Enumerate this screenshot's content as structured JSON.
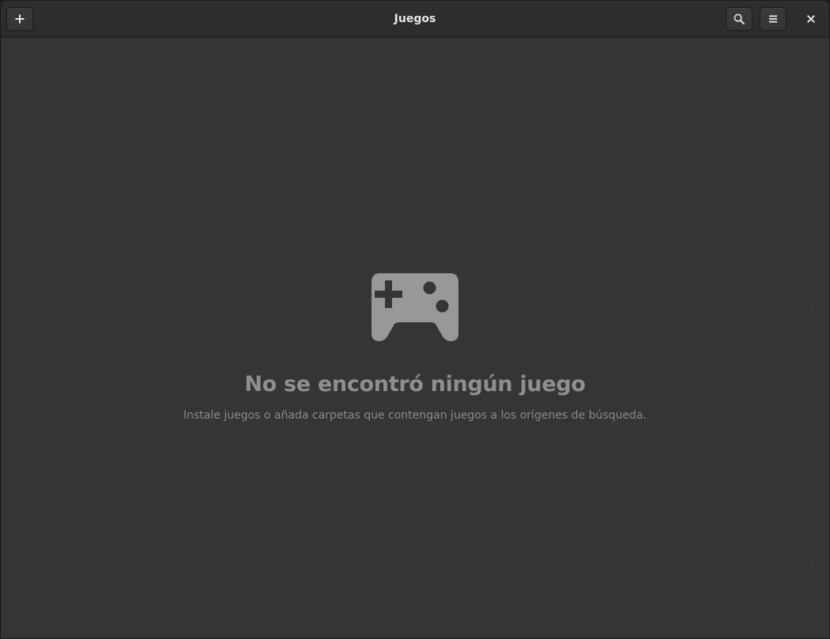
{
  "window": {
    "title": "Juegos"
  },
  "headerbar": {
    "add_icon": "plus-icon",
    "search_icon": "search-icon",
    "menu_icon": "hamburger-menu-icon",
    "close_icon": "close-icon"
  },
  "empty_state": {
    "icon": "gamepad-icon",
    "title": "No se encontró ningún juego",
    "description": "Instale juegos o añada carpetas que contengan juegos a los orígenes de búsqueda."
  },
  "colors": {
    "background": "#353535",
    "headerbar": "#2d2d2d",
    "title_text": "#e6e6e6",
    "placeholder": "#8f8f8f"
  }
}
